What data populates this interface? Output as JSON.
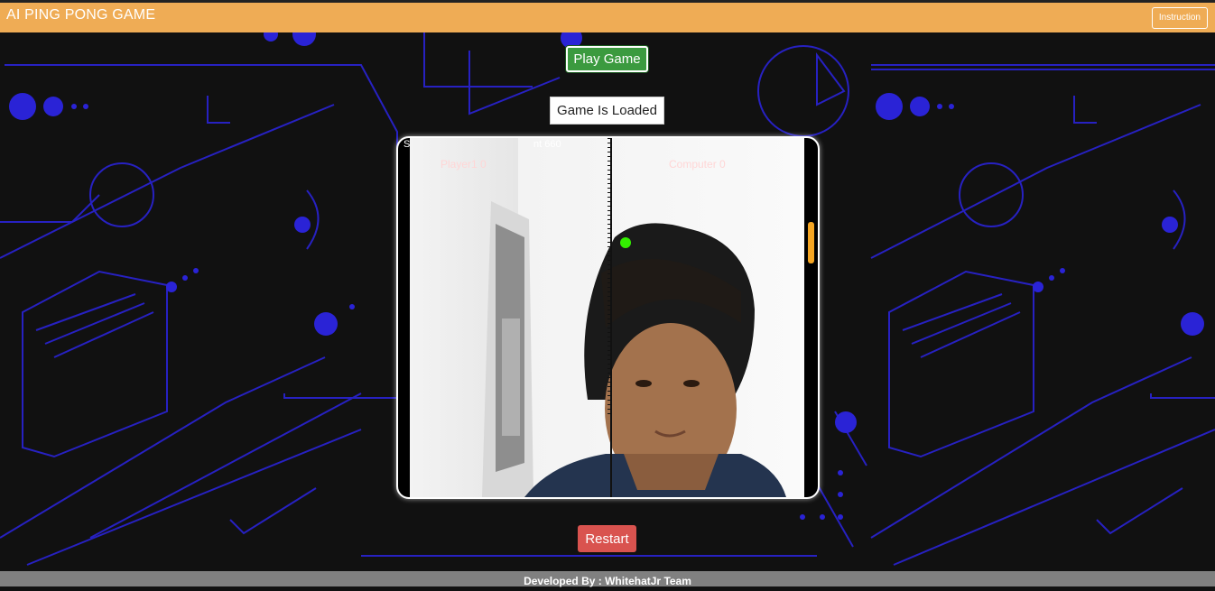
{
  "header": {
    "title": "AI PING PONG GAME",
    "instruction_label": "Instruction"
  },
  "controls": {
    "play_label": "Play Game",
    "status_text": "Game Is Loaded",
    "restart_label": "Restart"
  },
  "game": {
    "top_overlay_left": "S",
    "top_overlay_right": "nt 660",
    "player_score": "Player1 0",
    "computer_score": "Computer 0"
  },
  "footer": {
    "text": "Developed By : WhitehatJr Team"
  },
  "colors": {
    "header": "#efac55",
    "play": "#3b9a3f",
    "restart": "#d9534f",
    "ball": "#33ee00",
    "paddle": "#f5a623",
    "footer": "#808080",
    "art": "#2a23d6"
  }
}
